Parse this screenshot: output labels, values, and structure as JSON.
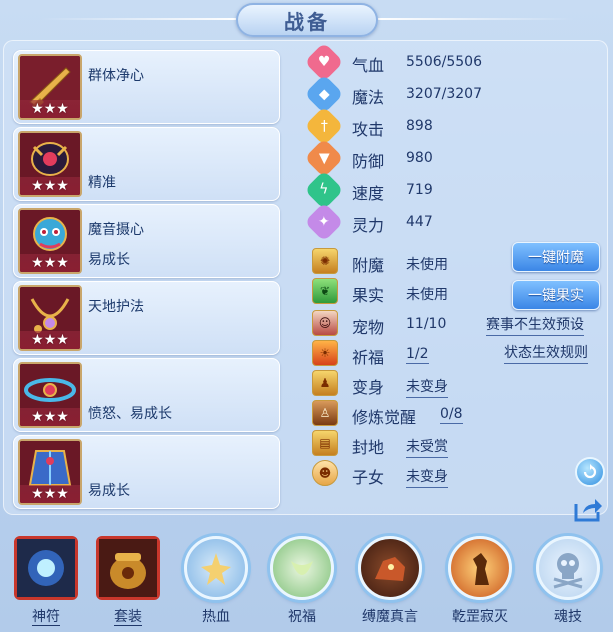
{
  "title": "战备",
  "cards": [
    {
      "label": "群体净心",
      "stars": "★★★"
    },
    {
      "label": "精准",
      "stars": "★★★"
    },
    {
      "label": "魔音摄心",
      "sub": "易成长",
      "stars": "★★★"
    },
    {
      "label": "天地护法",
      "stars": "★★★"
    },
    {
      "label": "愤怒、易成长",
      "stars": "★★★"
    },
    {
      "label": "易成长",
      "stars": "★★★"
    }
  ],
  "stats": [
    {
      "label": "气血",
      "value": "5506/5506",
      "icon": "heart-icon",
      "color": "#f06a8e"
    },
    {
      "label": "魔法",
      "value": "3207/3207",
      "icon": "shield-icon",
      "color": "#5aa6ef"
    },
    {
      "label": "攻击",
      "value": "898",
      "icon": "sword-icon",
      "color": "#f4b63c"
    },
    {
      "label": "防御",
      "value": "980",
      "icon": "armor-icon",
      "color": "#f08a4a"
    },
    {
      "label": "速度",
      "value": "719",
      "icon": "lightning-icon",
      "color": "#2fc48a"
    },
    {
      "label": "灵力",
      "value": "447",
      "icon": "spirit-icon",
      "color": "#c48ae8"
    }
  ],
  "info": [
    {
      "label": "附魔",
      "value": "未使用"
    },
    {
      "label": "果实",
      "value": "未使用"
    },
    {
      "label": "宠物",
      "value": "11/10"
    },
    {
      "label": "祈福",
      "value": "1/2"
    },
    {
      "label": "变身",
      "value": "未变身"
    },
    {
      "label": "修炼觉醒",
      "value": "0/8"
    },
    {
      "label": "封地",
      "value": "未受赏"
    },
    {
      "label": "子女",
      "value": "未变身"
    }
  ],
  "buttons": {
    "enchant": "一键附魔",
    "fruit": "一键果实"
  },
  "links": {
    "preset": "赛事不生效预设",
    "rules": "状态生效规则"
  },
  "bottom": [
    {
      "label": "神符"
    },
    {
      "label": "套装"
    },
    {
      "label": "热血"
    },
    {
      "label": "祝福"
    },
    {
      "label": "缚魔真言"
    },
    {
      "label": "乾罡寂灭"
    },
    {
      "label": "魂技"
    }
  ]
}
